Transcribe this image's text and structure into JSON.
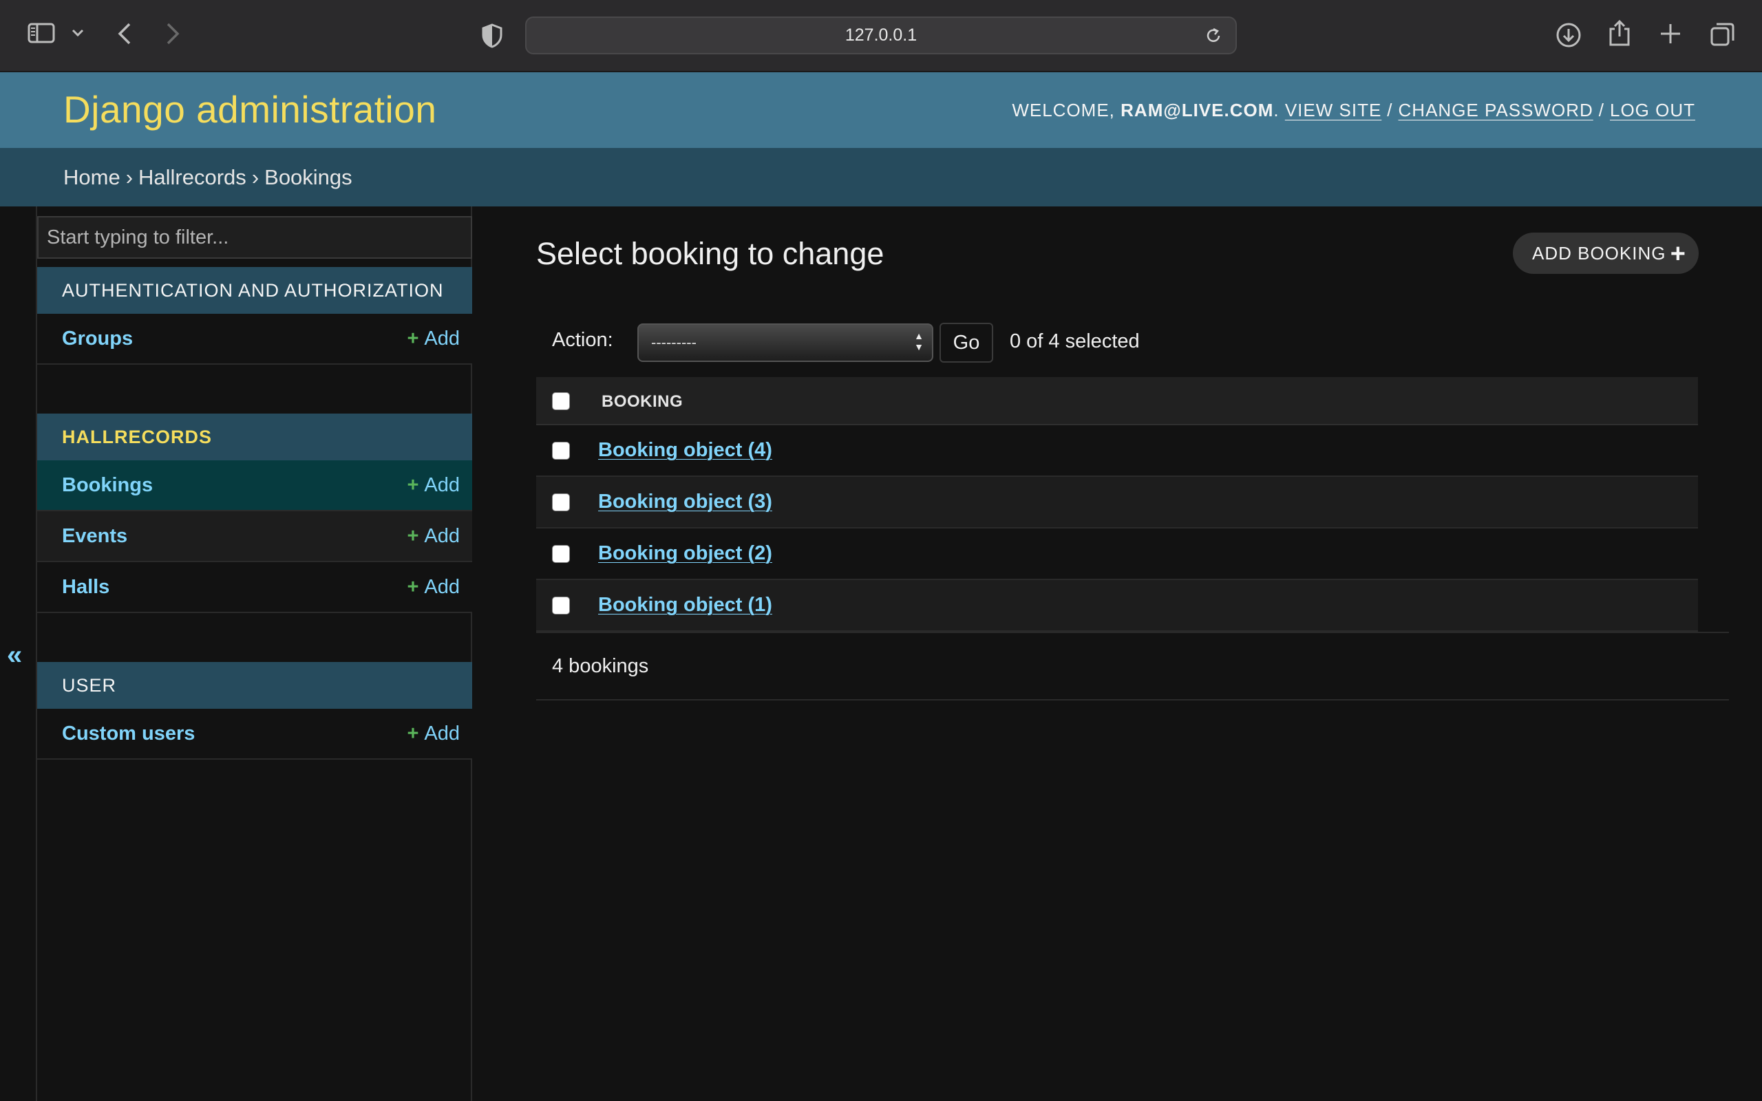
{
  "browser": {
    "url": "127.0.0.1",
    "icons": [
      "sidebar-icon",
      "chevron-down-icon",
      "back-icon",
      "forward-icon",
      "shield-icon",
      "reload-icon",
      "download-icon",
      "share-icon",
      "new-tab-icon",
      "tabs-overview-icon"
    ]
  },
  "header": {
    "site_name": "Django administration",
    "welcome": "WELCOME, ",
    "user": "RAM@LIVE.COM",
    "view_site": "VIEW SITE",
    "change_password": "CHANGE PASSWORD",
    "log_out": "LOG OUT",
    "sep": "/"
  },
  "breadcrumbs": {
    "home": "Home",
    "app": "Hallrecords",
    "model": "Bookings",
    "arrow": "›"
  },
  "sidebar": {
    "filter_placeholder": "Start typing to filter...",
    "add_label": "Add",
    "plus": "+",
    "collapse": "«",
    "modules": [
      {
        "caption": "AUTHENTICATION AND AUTHORIZATION",
        "models": [
          "Groups"
        ]
      },
      {
        "caption": "HALLRECORDS",
        "models": [
          "Bookings",
          "Events",
          "Halls"
        ]
      },
      {
        "caption": "USER",
        "models": [
          "Custom users"
        ]
      }
    ]
  },
  "main": {
    "title": "Select booking to change",
    "add_button": "ADD BOOKING",
    "add_plus": "+",
    "action_label": "Action:",
    "action_selected": "---------",
    "go": "Go",
    "counter": "0 of 4 selected",
    "column_header": "BOOKING",
    "rows": [
      "Booking object (4)",
      "Booking object (3)",
      "Booking object (2)",
      "Booking object (1)"
    ],
    "paginator": "4 bookings"
  },
  "colors": {
    "header_bg": "#417690",
    "breadcrumb_bg": "#264b5d",
    "brand_yellow": "#f5dd5d",
    "link_blue": "#81d4fa",
    "add_green": "#5bb55b",
    "page_bg": "#121212"
  }
}
